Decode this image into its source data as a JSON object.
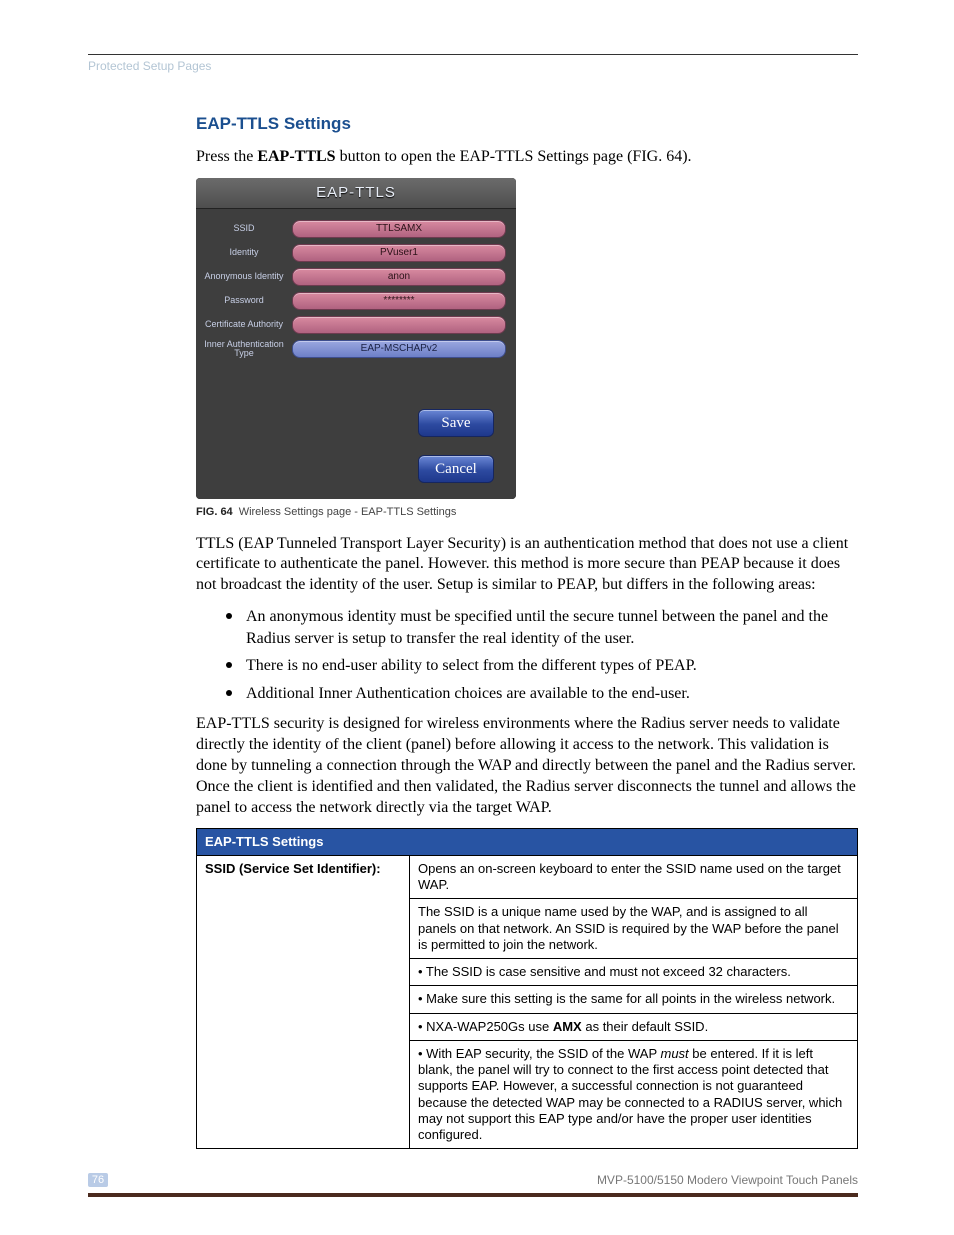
{
  "header": {
    "section": "Protected Setup Pages"
  },
  "heading": "EAP-TTLS Settings",
  "intro": {
    "pre": "Press the ",
    "bold": "EAP-TTLS",
    "post": " button to open the EAP-TTLS Settings page (FIG. 64)."
  },
  "panel": {
    "title": "EAP-TTLS",
    "rows": [
      {
        "label": "SSID",
        "value": "TTLSAMX",
        "style": "pink"
      },
      {
        "label": "Identity",
        "value": "PVuser1",
        "style": "pink"
      },
      {
        "label": "Anonymous Identity",
        "value": "anon",
        "style": "pink"
      },
      {
        "label": "Password",
        "value": "********",
        "style": "pink"
      },
      {
        "label": "Certificate Authority",
        "value": "",
        "style": "pink"
      },
      {
        "label": "Inner Authentication Type",
        "value": "EAP-MSCHAPv2",
        "style": "blue"
      }
    ],
    "save": "Save",
    "cancel": "Cancel"
  },
  "figure": {
    "label": "FIG. 64",
    "caption": "Wireless Settings page - EAP-TTLS Settings"
  },
  "para1": "TTLS (EAP Tunneled Transport Layer Security) is an authentication method that does not use a client certificate to authenticate the panel. However. this method is more secure than PEAP because it does not broadcast the identity of the user. Setup is similar to PEAP, but differs in the following areas:",
  "bullets": [
    "An anonymous identity must be specified until the secure tunnel between the panel and the Radius server is setup to transfer the real identity of the user.",
    "There is no end-user ability to select from the different types of PEAP.",
    "Additional Inner Authentication choices are available to the end-user."
  ],
  "para2": "EAP-TTLS security is designed for wireless environments where the Radius server needs to validate directly the identity of the client (panel) before allowing it access to the network. This validation is done by tunneling a connection through the WAP and directly between the panel and the Radius server. Once the client is identified and then validated, the Radius server disconnects the tunnel and allows the panel to access the network directly via the target WAP.",
  "table": {
    "title": "EAP-TTLS Settings",
    "row_label": "SSID (Service Set Identifier):",
    "c1": "Opens an on-screen keyboard to enter the SSID name used on the target WAP.",
    "c2": "The SSID is a unique name used by the WAP, and is assigned to all panels on that network. An SSID is required by the WAP before the panel is permitted to join the network.",
    "c3": "• The SSID is case sensitive and must not exceed 32 characters.",
    "c4": "• Make sure this setting is the same for all points in the wireless network.",
    "c5_pre": "• NXA-WAP250Gs use ",
    "c5_bold": "AMX",
    "c5_post": " as their default SSID.",
    "c6_pre": "• With EAP security, the SSID of the WAP ",
    "c6_italic": "must",
    "c6_post": " be entered. If it is left blank, the panel will try to connect to the first access point detected that supports EAP. However, a successful connection is not guaranteed because the detected WAP may be connected to a RADIUS server, which may not support this EAP type and/or have the proper user identities configured."
  },
  "footer": {
    "page": "76",
    "product": "MVP-5100/5150 Modero Viewpoint  Touch Panels"
  }
}
